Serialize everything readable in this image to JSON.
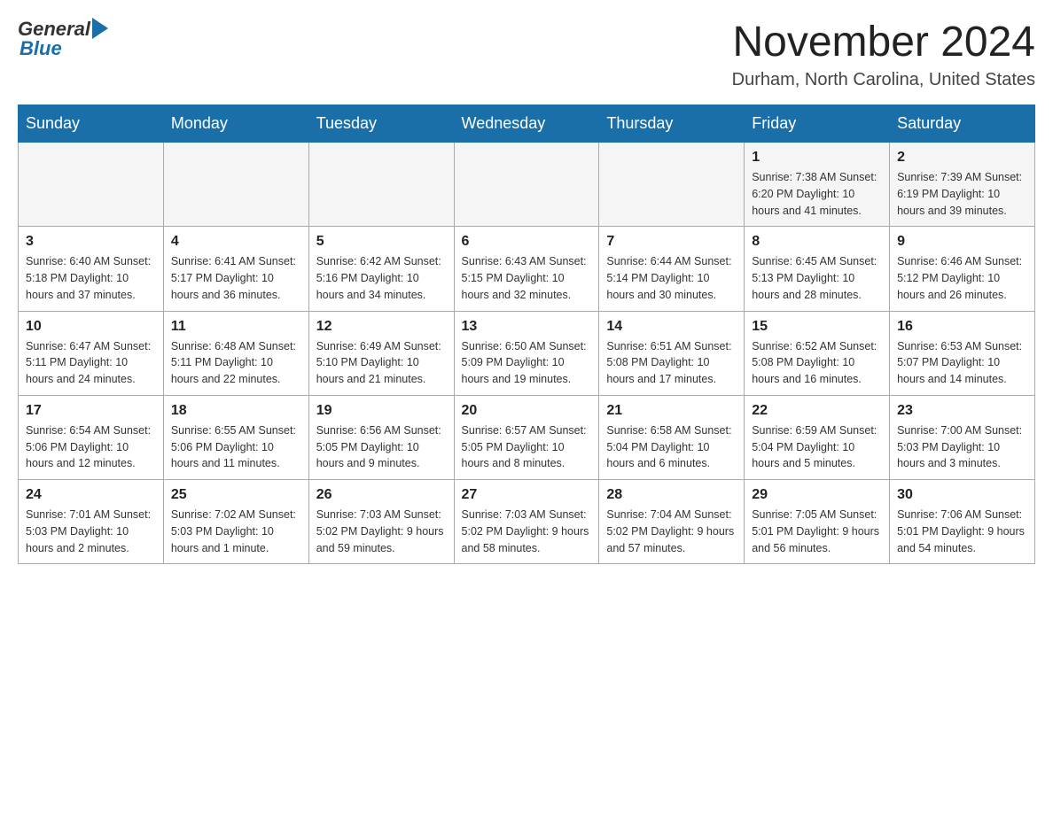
{
  "header": {
    "logo_general": "General",
    "logo_blue": "Blue",
    "month_title": "November 2024",
    "location": "Durham, North Carolina, United States"
  },
  "days_of_week": [
    "Sunday",
    "Monday",
    "Tuesday",
    "Wednesday",
    "Thursday",
    "Friday",
    "Saturday"
  ],
  "weeks": [
    [
      {
        "day": "",
        "info": ""
      },
      {
        "day": "",
        "info": ""
      },
      {
        "day": "",
        "info": ""
      },
      {
        "day": "",
        "info": ""
      },
      {
        "day": "",
        "info": ""
      },
      {
        "day": "1",
        "info": "Sunrise: 7:38 AM\nSunset: 6:20 PM\nDaylight: 10 hours and 41 minutes."
      },
      {
        "day": "2",
        "info": "Sunrise: 7:39 AM\nSunset: 6:19 PM\nDaylight: 10 hours and 39 minutes."
      }
    ],
    [
      {
        "day": "3",
        "info": "Sunrise: 6:40 AM\nSunset: 5:18 PM\nDaylight: 10 hours and 37 minutes."
      },
      {
        "day": "4",
        "info": "Sunrise: 6:41 AM\nSunset: 5:17 PM\nDaylight: 10 hours and 36 minutes."
      },
      {
        "day": "5",
        "info": "Sunrise: 6:42 AM\nSunset: 5:16 PM\nDaylight: 10 hours and 34 minutes."
      },
      {
        "day": "6",
        "info": "Sunrise: 6:43 AM\nSunset: 5:15 PM\nDaylight: 10 hours and 32 minutes."
      },
      {
        "day": "7",
        "info": "Sunrise: 6:44 AM\nSunset: 5:14 PM\nDaylight: 10 hours and 30 minutes."
      },
      {
        "day": "8",
        "info": "Sunrise: 6:45 AM\nSunset: 5:13 PM\nDaylight: 10 hours and 28 minutes."
      },
      {
        "day": "9",
        "info": "Sunrise: 6:46 AM\nSunset: 5:12 PM\nDaylight: 10 hours and 26 minutes."
      }
    ],
    [
      {
        "day": "10",
        "info": "Sunrise: 6:47 AM\nSunset: 5:11 PM\nDaylight: 10 hours and 24 minutes."
      },
      {
        "day": "11",
        "info": "Sunrise: 6:48 AM\nSunset: 5:11 PM\nDaylight: 10 hours and 22 minutes."
      },
      {
        "day": "12",
        "info": "Sunrise: 6:49 AM\nSunset: 5:10 PM\nDaylight: 10 hours and 21 minutes."
      },
      {
        "day": "13",
        "info": "Sunrise: 6:50 AM\nSunset: 5:09 PM\nDaylight: 10 hours and 19 minutes."
      },
      {
        "day": "14",
        "info": "Sunrise: 6:51 AM\nSunset: 5:08 PM\nDaylight: 10 hours and 17 minutes."
      },
      {
        "day": "15",
        "info": "Sunrise: 6:52 AM\nSunset: 5:08 PM\nDaylight: 10 hours and 16 minutes."
      },
      {
        "day": "16",
        "info": "Sunrise: 6:53 AM\nSunset: 5:07 PM\nDaylight: 10 hours and 14 minutes."
      }
    ],
    [
      {
        "day": "17",
        "info": "Sunrise: 6:54 AM\nSunset: 5:06 PM\nDaylight: 10 hours and 12 minutes."
      },
      {
        "day": "18",
        "info": "Sunrise: 6:55 AM\nSunset: 5:06 PM\nDaylight: 10 hours and 11 minutes."
      },
      {
        "day": "19",
        "info": "Sunrise: 6:56 AM\nSunset: 5:05 PM\nDaylight: 10 hours and 9 minutes."
      },
      {
        "day": "20",
        "info": "Sunrise: 6:57 AM\nSunset: 5:05 PM\nDaylight: 10 hours and 8 minutes."
      },
      {
        "day": "21",
        "info": "Sunrise: 6:58 AM\nSunset: 5:04 PM\nDaylight: 10 hours and 6 minutes."
      },
      {
        "day": "22",
        "info": "Sunrise: 6:59 AM\nSunset: 5:04 PM\nDaylight: 10 hours and 5 minutes."
      },
      {
        "day": "23",
        "info": "Sunrise: 7:00 AM\nSunset: 5:03 PM\nDaylight: 10 hours and 3 minutes."
      }
    ],
    [
      {
        "day": "24",
        "info": "Sunrise: 7:01 AM\nSunset: 5:03 PM\nDaylight: 10 hours and 2 minutes."
      },
      {
        "day": "25",
        "info": "Sunrise: 7:02 AM\nSunset: 5:03 PM\nDaylight: 10 hours and 1 minute."
      },
      {
        "day": "26",
        "info": "Sunrise: 7:03 AM\nSunset: 5:02 PM\nDaylight: 9 hours and 59 minutes."
      },
      {
        "day": "27",
        "info": "Sunrise: 7:03 AM\nSunset: 5:02 PM\nDaylight: 9 hours and 58 minutes."
      },
      {
        "day": "28",
        "info": "Sunrise: 7:04 AM\nSunset: 5:02 PM\nDaylight: 9 hours and 57 minutes."
      },
      {
        "day": "29",
        "info": "Sunrise: 7:05 AM\nSunset: 5:01 PM\nDaylight: 9 hours and 56 minutes."
      },
      {
        "day": "30",
        "info": "Sunrise: 7:06 AM\nSunset: 5:01 PM\nDaylight: 9 hours and 54 minutes."
      }
    ]
  ]
}
